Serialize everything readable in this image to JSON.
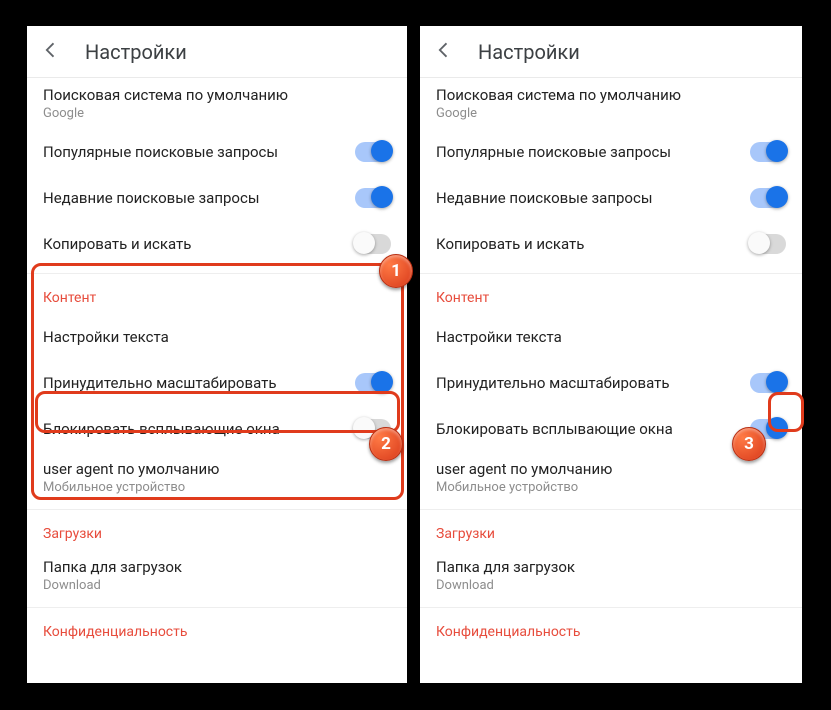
{
  "header": {
    "title": "Настройки"
  },
  "top": {
    "search_engine_label": "Поисковая система по умолчанию",
    "search_engine_value": "Google",
    "popular_searches": "Популярные поисковые запросы",
    "recent_searches": "Недавние поисковые запросы",
    "copy_search": "Копировать и искать"
  },
  "content": {
    "section": "Контент",
    "text_settings": "Настройки текста",
    "force_zoom": "Принудительно масштабировать",
    "block_popups": "Блокировать всплывающие окна",
    "ua_label": "user agent по умолчанию",
    "ua_value": "Мобильное устройство"
  },
  "downloads": {
    "section": "Загрузки",
    "folder_label": "Папка для загрузок",
    "folder_value": "Download"
  },
  "privacy": {
    "section": "Конфиденциальность"
  },
  "annot": {
    "b1": "1",
    "b2": "2",
    "b3": "3"
  }
}
